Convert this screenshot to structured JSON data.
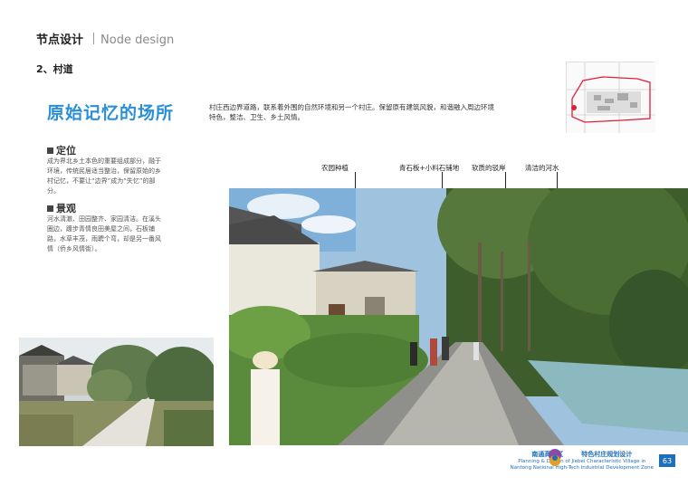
{
  "header": {
    "title_cn": "节点设计",
    "title_en": "Node design"
  },
  "subtitle": "2、村道",
  "big_title": "原始记忆的场所",
  "description": "村庄西边界道路，联系着外围的自然环境和另一个村庄。保留原有建筑风貌，和谐融入周边环境特色，整洁、卫生、乡土风情。",
  "sections": [
    {
      "heading": "定位",
      "text": "成为界北乡土本色的重要组成部分，融于环境，传统民居适当整治，保留原始的乡村记忆，不要让“边界”成为“失忆”的部分。"
    },
    {
      "heading": "景观",
      "text": "河水清澈、田园整齐、家园清洁。在溪头圈边，踱步青情良田美屋之间，石板铺路，水草丰茂，雨聘个弯，却是另一番风情（侨乡风情街）。"
    }
  ],
  "callouts": [
    {
      "label": "农园种植"
    },
    {
      "label": "青石板+小料石铺地"
    },
    {
      "label": "软质的驳岸"
    },
    {
      "label": "清洁的河水"
    }
  ],
  "footer": {
    "org_left": "南通高新区",
    "org_right": "特色村庄规划设计",
    "en_line1": "Planning & Design of Jiebei Characteristic Village in",
    "en_line2": "Nantong National High-Tech Industrial Development Zone",
    "page_number": "63"
  },
  "colors": {
    "accent": "#2a8fd6",
    "footer_blue": "#1f6fb8",
    "map_red": "#e0203a"
  }
}
